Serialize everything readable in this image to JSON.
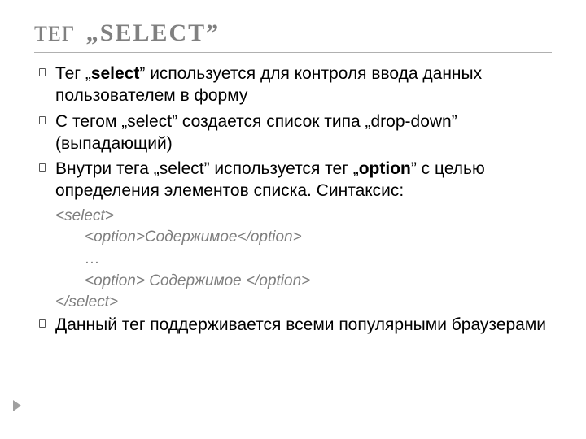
{
  "title": {
    "pre": "ТЕГ",
    "main": "„SELECT”"
  },
  "bullets": {
    "b1": "Тег „<b>select</b>” используется для контроля ввода данных пользователем в форму",
    "b2": "С тегом „select” создается список типа  „drop-down” (выпадающий)",
    "b3": "Внутри тега „select” используется тег „<b>option</b>” с целью определения элементов списка. Синтаксис:",
    "b4": "Данный тег поддерживается всеми популярными браузерами"
  },
  "code": {
    "l1": "<select>",
    "l2": "<option>Содержимое</option>",
    "l3": "…",
    "l4": "<option> Содержимое </option>",
    "l5": "</select>"
  }
}
